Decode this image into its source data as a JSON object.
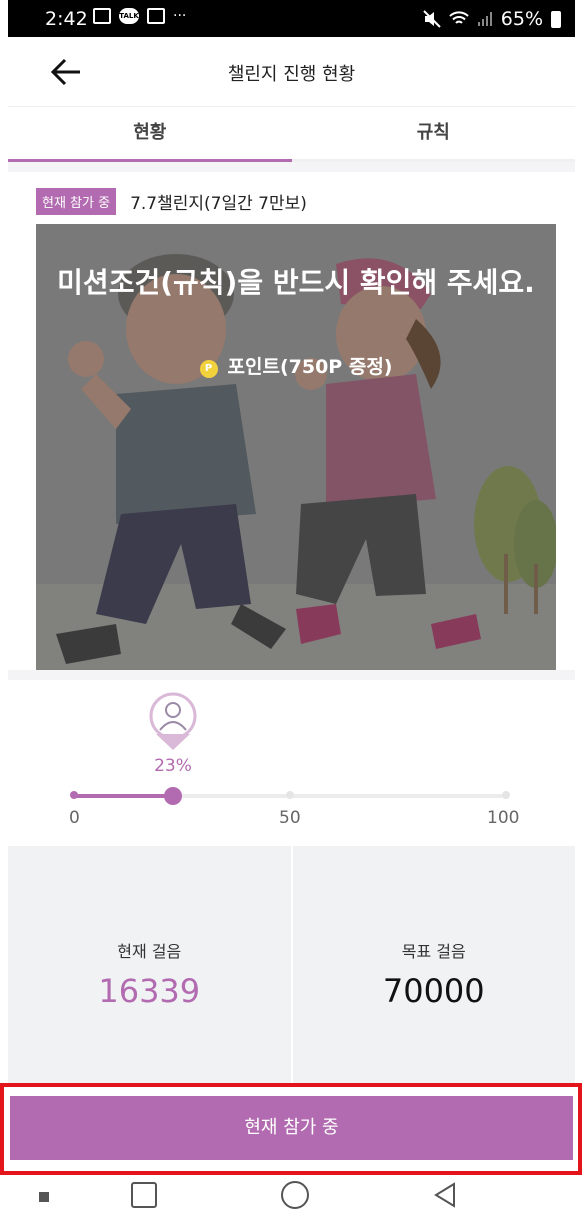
{
  "status_bar": {
    "time": "2:42",
    "talk": "TALK",
    "more": "···",
    "battery": "65%"
  },
  "header": {
    "title": "챌린지 진행 현황"
  },
  "tabs": [
    {
      "label": "현황",
      "active": true
    },
    {
      "label": "규칙",
      "active": false
    }
  ],
  "challenge": {
    "badge": "현재 참가 중",
    "name": "7.7챌린지(7일간 7만보)"
  },
  "banner": {
    "title": "미션조건(규칙)을 반드시 확인해 주세요.",
    "coin": "P",
    "points": "포인트(750P 증정)"
  },
  "progress": {
    "percent_label": "23%",
    "percent": 23,
    "ticks": [
      "0",
      "50",
      "100"
    ]
  },
  "stats": {
    "current": {
      "label": "현재 걸음",
      "value": "16339"
    },
    "goal": {
      "label": "목표 걸음",
      "value": "70000"
    }
  },
  "cta": {
    "label": "현재 참가 중"
  },
  "colors": {
    "accent": "#b26bb0",
    "highlight": "#e4141b"
  },
  "icons": [
    "back-arrow-icon",
    "avatar-icon",
    "coin-icon",
    "recent-apps-icon",
    "home-icon",
    "nav-back-icon"
  ]
}
